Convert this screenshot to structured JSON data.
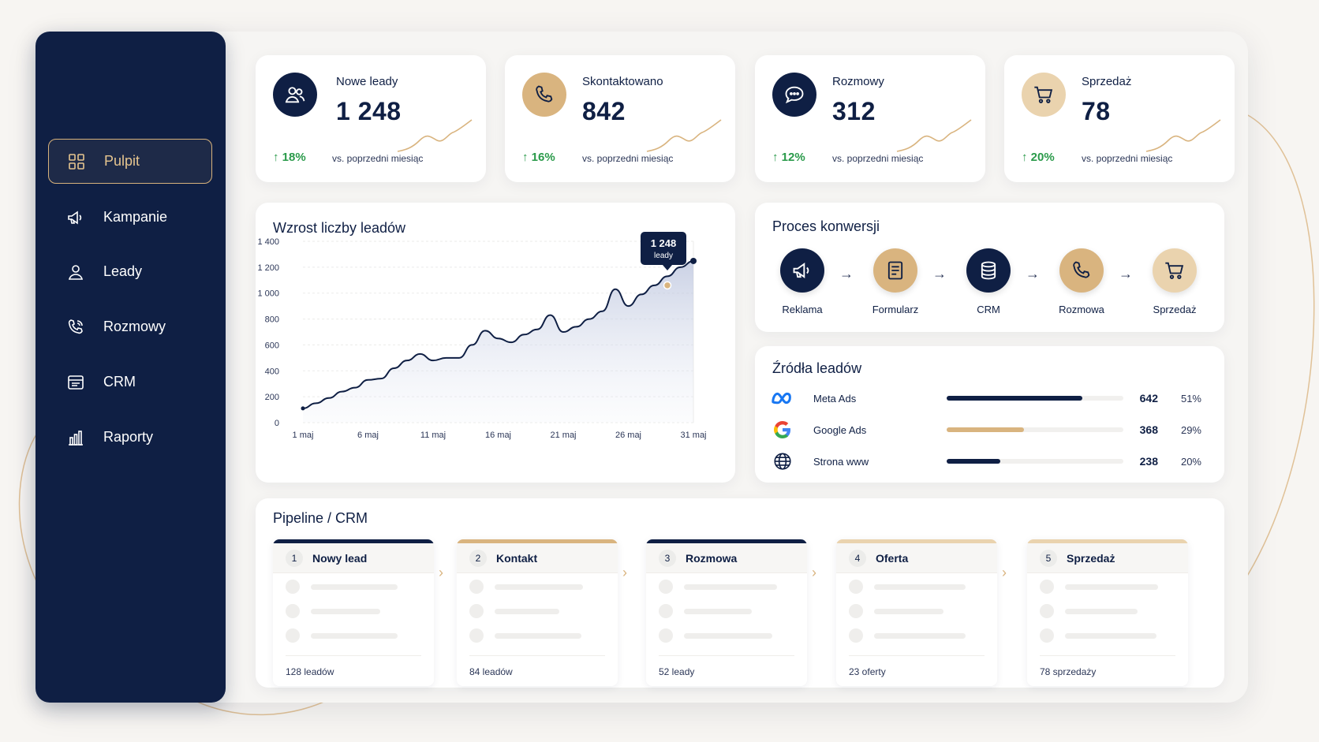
{
  "sidebar": {
    "items": [
      {
        "label": "Pulpit",
        "icon": "grid-icon",
        "active": true
      },
      {
        "label": "Kampanie",
        "icon": "megaphone-icon",
        "active": false
      },
      {
        "label": "Leady",
        "icon": "user-icon",
        "active": false
      },
      {
        "label": "Rozmowy",
        "icon": "phone-call-icon",
        "active": false
      },
      {
        "label": "CRM",
        "icon": "crm-icon",
        "active": false
      },
      {
        "label": "Raporty",
        "icon": "bar-chart-icon",
        "active": false
      }
    ]
  },
  "kpis": [
    {
      "label": "Nowe leady",
      "value": "1 248",
      "delta": "18%",
      "vs": "vs. poprzedni miesiąc",
      "icon": "users-icon"
    },
    {
      "label": "Skontaktowano",
      "value": "842",
      "delta": "16%",
      "vs": "vs. poprzedni miesiąc",
      "icon": "phone-icon"
    },
    {
      "label": "Rozmowy",
      "value": "312",
      "delta": "12%",
      "vs": "vs. poprzedni miesiąc",
      "icon": "chat-icon"
    },
    {
      "label": "Sprzedaż",
      "value": "78",
      "delta": "20%",
      "vs": "vs. poprzedni miesiąc",
      "icon": "cart-icon"
    }
  ],
  "growth": {
    "title": "Wzrost liczby leadów",
    "tooltip_value": "1 248",
    "tooltip_unit": "leady"
  },
  "chart_data": {
    "type": "area",
    "title": "Wzrost liczby leadów",
    "xlabel": "",
    "ylabel": "",
    "ylim": [
      0,
      1400
    ],
    "yticks": [
      "1 400",
      "1 200",
      "1 000",
      "800",
      "600",
      "400",
      "200",
      "0"
    ],
    "xticks": [
      "1 maj",
      "6 maj",
      "11 maj",
      "16 maj",
      "21 maj",
      "26 maj",
      "31 maj"
    ],
    "x": [
      1,
      2,
      3,
      4,
      5,
      6,
      7,
      8,
      9,
      10,
      11,
      12,
      13,
      14,
      15,
      16,
      17,
      18,
      19,
      20,
      21,
      22,
      23,
      24,
      25,
      26,
      27,
      28,
      29,
      30,
      31
    ],
    "values": [
      110,
      150,
      190,
      240,
      270,
      330,
      340,
      420,
      480,
      530,
      480,
      500,
      500,
      600,
      710,
      650,
      620,
      680,
      720,
      830,
      700,
      740,
      800,
      860,
      1030,
      900,
      990,
      1060,
      1130,
      1200,
      1248
    ],
    "highlight": {
      "x": 29,
      "value": 1060
    },
    "grid": true
  },
  "process": {
    "title": "Proces konwersji",
    "steps": [
      {
        "label": "Reklama",
        "icon": "megaphone-icon"
      },
      {
        "label": "Formularz",
        "icon": "form-icon"
      },
      {
        "label": "CRM",
        "icon": "database-icon"
      },
      {
        "label": "Rozmowa",
        "icon": "phone-icon"
      },
      {
        "label": "Sprzedaż",
        "icon": "cart-icon"
      }
    ],
    "arrow": "→"
  },
  "sources": {
    "title": "Źródła leadów",
    "rows": [
      {
        "name": "Meta Ads",
        "count": "642",
        "pct": "51%",
        "share": 0.51,
        "color": "#0f1f44",
        "icon": "meta-icon"
      },
      {
        "name": "Google Ads",
        "count": "368",
        "pct": "29%",
        "share": 0.29,
        "color": "#d9b47f",
        "icon": "google-icon"
      },
      {
        "name": "Strona www",
        "count": "238",
        "pct": "20%",
        "share": 0.2,
        "color": "#0f1f44",
        "icon": "globe-icon"
      }
    ]
  },
  "pipeline": {
    "title": "Pipeline / CRM",
    "stages": [
      {
        "num": "1",
        "name": "Nowy lead",
        "count": "128 leadów",
        "color": "#0f1f44"
      },
      {
        "num": "2",
        "name": "Kontakt",
        "count": "84 leadów",
        "color": "#d9b47f"
      },
      {
        "num": "3",
        "name": "Rozmowa",
        "count": "52 leady",
        "color": "#0f1f44"
      },
      {
        "num": "4",
        "name": "Oferta",
        "count": "23 oferty",
        "color": "#ead3ae"
      },
      {
        "num": "5",
        "name": "Sprzedaż",
        "count": "78 sprzedaży",
        "color": "#ead3ae"
      }
    ]
  },
  "colors": {
    "navy": "#0f1f44",
    "gold": "#d9b47f",
    "green": "#2a9a4a"
  }
}
